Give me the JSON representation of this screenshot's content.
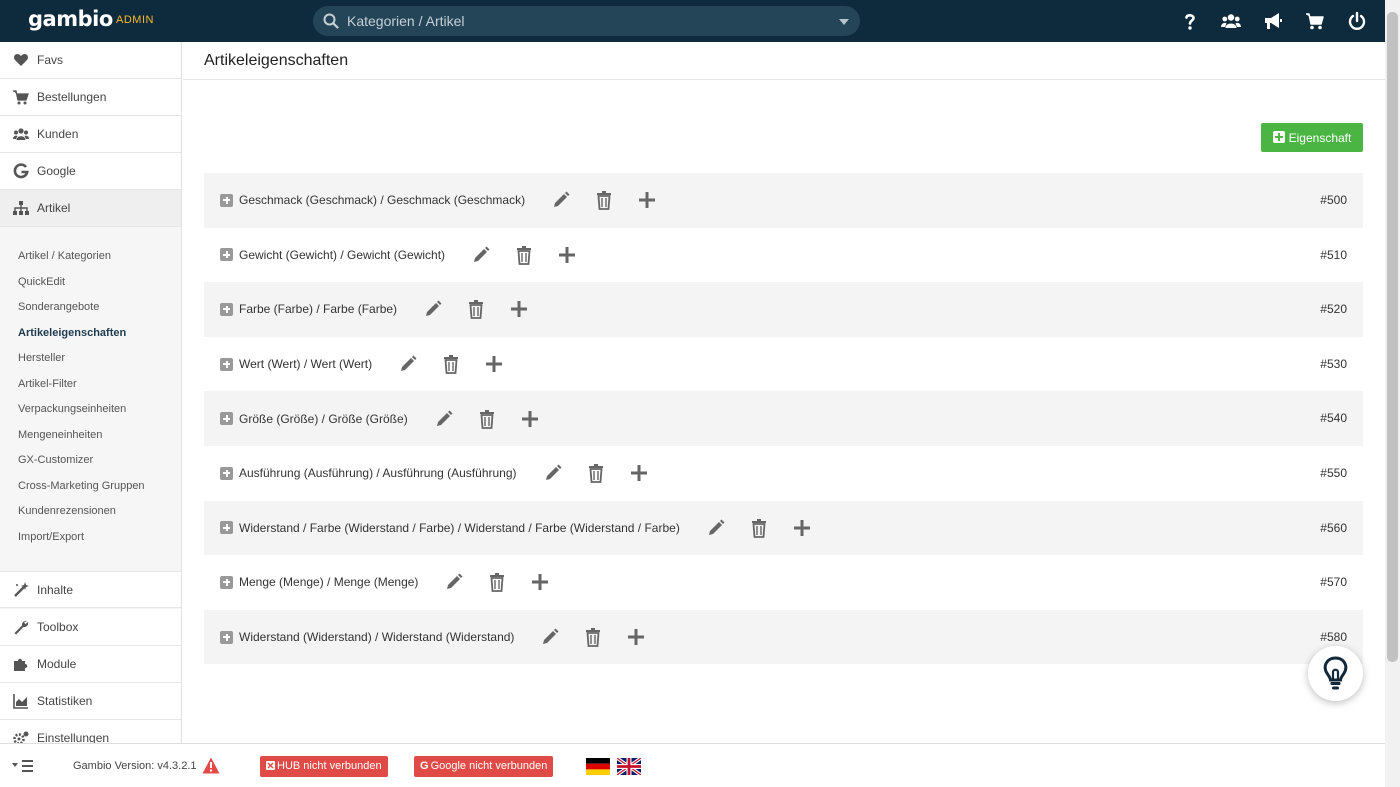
{
  "header": {
    "logo": "gambio",
    "logo_sub": "ADMIN",
    "search_placeholder": "Kategorien / Artikel",
    "icons": [
      "help-icon",
      "customers-icon",
      "megaphone-icon",
      "cart-icon",
      "power-icon"
    ]
  },
  "sidebar": {
    "items_top": [
      {
        "label": "Favs",
        "icon": "heart-icon"
      },
      {
        "label": "Bestellungen",
        "icon": "cart-icon"
      },
      {
        "label": "Kunden",
        "icon": "users-icon"
      },
      {
        "label": "Google",
        "icon": "google-icon"
      },
      {
        "label": "Artikel",
        "icon": "sitemap-icon"
      }
    ],
    "sub_items": [
      "Artikel / Kategorien",
      "QuickEdit",
      "Sonderangebote",
      "Artikeleigenschaften",
      "Hersteller",
      "Artikel-Filter",
      "Verpackungseinheiten",
      "Mengeneinheiten",
      "GX-Customizer",
      "Cross-Marketing Gruppen",
      "Kundenrezensionen",
      "Import/Export"
    ],
    "current_sub": "Artikeleigenschaften",
    "items_bottom": [
      {
        "label": "Inhalte",
        "icon": "wand-icon"
      },
      {
        "label": "Toolbox",
        "icon": "wrench-icon"
      },
      {
        "label": "Module",
        "icon": "puzzle-icon"
      },
      {
        "label": "Statistiken",
        "icon": "chart-icon"
      },
      {
        "label": "Einstellungen",
        "icon": "cogs-icon"
      }
    ]
  },
  "main": {
    "title": "Artikeleigenschaften",
    "add_button": "Eigenschaft",
    "properties": [
      {
        "name": "Geschmack (Geschmack)  /  Geschmack (Geschmack)",
        "id": "#500"
      },
      {
        "name": "Gewicht (Gewicht)  /  Gewicht (Gewicht)",
        "id": "#510"
      },
      {
        "name": "Farbe (Farbe)  /  Farbe (Farbe)",
        "id": "#520"
      },
      {
        "name": "Wert (Wert)  /  Wert (Wert)",
        "id": "#530"
      },
      {
        "name": "Größe (Größe)  /  Größe (Größe)",
        "id": "#540"
      },
      {
        "name": "Ausführung (Ausführung)  /  Ausführung (Ausführung)",
        "id": "#550"
      },
      {
        "name": "Widerstand / Farbe (Widerstand / Farbe)  /  Widerstand / Farbe (Widerstand / Farbe)",
        "id": "#560"
      },
      {
        "name": "Menge (Menge)  /  Menge (Menge)",
        "id": "#570"
      },
      {
        "name": "Widerstand (Widerstand)  /  Widerstand (Widerstand)",
        "id": "#580"
      }
    ]
  },
  "footer": {
    "version": "Gambio Version: v4.3.2.1",
    "hub_status": "HUB nicht verbunden",
    "google_status": "Google nicht verbunden",
    "languages": [
      "de-flag-icon",
      "uk-flag-icon"
    ]
  },
  "colors": {
    "topbar": "#0e2a3d",
    "accent_green": "#4bb543",
    "status_red": "#e14b47",
    "admin_yellow": "#f5b82e"
  }
}
